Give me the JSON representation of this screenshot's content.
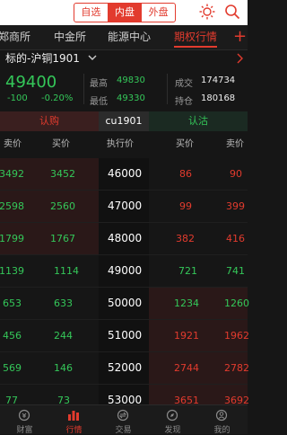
{
  "top": {
    "segments": [
      "自选",
      "内盘",
      "外盘"
    ],
    "active_segment": "内盘"
  },
  "tabs": [
    "郑商所",
    "中金所",
    "能源中心",
    "期权行情"
  ],
  "active_tab": "期权行情",
  "symbol": {
    "name": "标的-沪铜1901"
  },
  "quote": {
    "price": "49400",
    "change": "-100",
    "change_pct": "-0.20%",
    "high_label": "最高",
    "high": "49830",
    "low_label": "最低",
    "low": "49330",
    "volume_label": "成交",
    "volume": "174734",
    "oi_label": "持仓",
    "oi": "180168"
  },
  "section": {
    "call": "认购",
    "contract": "cu1901",
    "put": "认沽"
  },
  "table": {
    "headers": {
      "call_ask": "卖价",
      "call_bid": "买价",
      "strike": "执行价",
      "put_bid": "买价",
      "put_ask": "卖价"
    },
    "rows": [
      {
        "call_ask": "3492",
        "call_bid": "3452",
        "strike": "46000",
        "put_bid": "86",
        "put_ask": "90"
      },
      {
        "call_ask": "2598",
        "call_bid": "2560",
        "strike": "47000",
        "put_bid": "99",
        "put_ask": "399"
      },
      {
        "call_ask": "1799",
        "call_bid": "1767",
        "strike": "48000",
        "put_bid": "382",
        "put_ask": "416"
      },
      {
        "call_ask": "1139",
        "call_bid": "1114",
        "strike": "49000",
        "put_bid": "721",
        "put_ask": "741"
      },
      {
        "call_ask": "653",
        "call_bid": "633",
        "strike": "50000",
        "put_bid": "1234",
        "put_ask": "1260"
      },
      {
        "call_ask": "456",
        "call_bid": "244",
        "strike": "51000",
        "put_bid": "1921",
        "put_ask": "1962"
      },
      {
        "call_ask": "569",
        "call_bid": "146",
        "strike": "52000",
        "put_bid": "2744",
        "put_ask": "2782"
      },
      {
        "call_ask": "77",
        "call_bid": "73",
        "strike": "53000",
        "put_bid": "3651",
        "put_ask": "3692"
      }
    ]
  },
  "bottom_nav": [
    "财富",
    "行情",
    "交易",
    "发现",
    "我的"
  ],
  "active_nav": "行情",
  "colors": {
    "up": "#e23b2e",
    "down": "#34c759",
    "bg": "#161616"
  }
}
